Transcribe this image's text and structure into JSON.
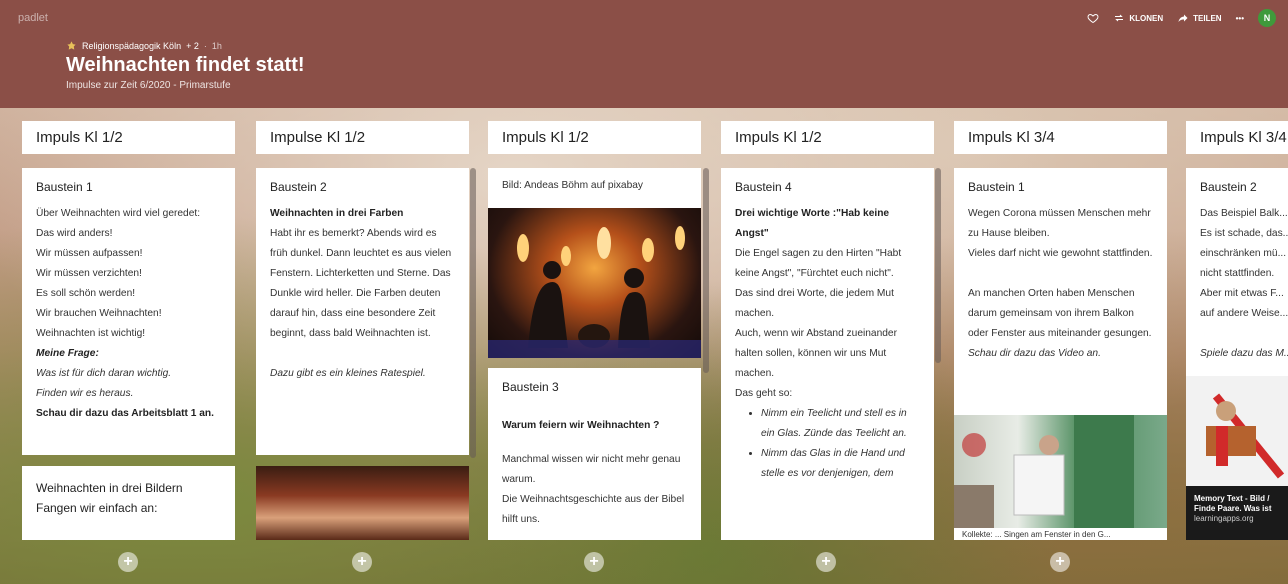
{
  "app": {
    "brand": "padlet"
  },
  "actions": {
    "klonen_label": "KLONEN",
    "teilen_label": "TEILEN",
    "more_label": "•••",
    "avatar_initial": "N"
  },
  "board": {
    "author": "Religionspädagogik Köln",
    "contributors": "+ 2",
    "sep": "·",
    "time": "1h",
    "title": "Weihnachten findet statt!",
    "subtitle": "Impulse zur Zeit 6/2020 - Primarstufe"
  },
  "columns": [
    {
      "header": "Impuls Kl 1/2",
      "posts": [
        {
          "title": "Baustein 1",
          "lines": [
            "Über Weihnachten wird viel geredet:",
            "Das wird anders!",
            "Wir müssen aufpassen!",
            "Wir müssen verzichten!",
            "Es soll schön werden!",
            "Wir brauchen Weihnachten!",
            "Weihnachten ist wichtig!"
          ],
          "question_label": "Meine Frage:",
          "question_lines": [
            "Was ist für dich daran wichtig.",
            "Finden wir es heraus."
          ],
          "closing": "Schau dir dazu das Arbeitsblatt 1 an."
        },
        {
          "title": "Weihnachten in drei Bildern Fangen wir einfach an:"
        }
      ]
    },
    {
      "header": "Impulse Kl 1/2",
      "posts": [
        {
          "title": "Baustein 2",
          "bold_lead": "Weihnachten in drei Farben",
          "body": "Habt ihr es bemerkt? Abends wird es früh dunkel. Dann leuchtet es aus vielen Fenstern. Lichterketten und Sterne. Das Dunkle wird heller. Die Farben deuten darauf hin, dass eine besondere Zeit beginnt, dass bald Weihnachten ist.",
          "italic_note": "Dazu gibt es ein kleines Ratespiel."
        }
      ]
    },
    {
      "header": "Impuls Kl 1/2",
      "posts": [
        {
          "caption": "Bild: Andeas Böhm auf pixabay"
        },
        {
          "title": "Baustein 3",
          "bold_lead": "Warum feiern wir Weihnachten ?",
          "body_lines": [
            "Manchmal wissen wir nicht mehr genau warum.",
            "Die Weihnachtsgeschichte aus der Bibel hilft uns."
          ]
        }
      ]
    },
    {
      "header": "Impuls Kl 1/2",
      "posts": [
        {
          "title": "Baustein 4",
          "bold_lead": "Drei wichtige Worte :\"Hab keine Angst\"",
          "body_lines": [
            "Die Engel sagen zu den Hirten \"Habt keine Angst\", \"Fürchtet euch nicht\".",
            "Das sind drei Worte, die jedem Mut machen.",
            "Auch, wenn wir Abstand zueinander halten sollen, können wir uns Mut machen.",
            "Das geht so:"
          ],
          "bullets": [
            "Nimm ein Teelicht und stell es in ein Glas. Zünde das Teelicht an.",
            "Nimm das Glas in die Hand und stelle es vor denjenigen, dem"
          ]
        }
      ]
    },
    {
      "header": "Impuls Kl 3/4",
      "posts": [
        {
          "title": "Baustein 1",
          "body_lines": [
            "Wegen Corona müssen Menschen mehr zu Hause bleiben.",
            "Vieles darf nicht wie gewohnt stattfinden.",
            "",
            "An manchen Orten haben Menschen darum gemeinsam von ihrem Balkon oder Fenster aus miteinander gesungen."
          ],
          "italic_note": "Schau dir dazu das Video an.",
          "image_caption": "Kollekte: ... Singen am Fenster in den G..."
        }
      ]
    },
    {
      "header": "Impuls Kl 3/4",
      "posts": [
        {
          "title": "Baustein 2",
          "body_lines": [
            "Das Beispiel Balk...",
            "Es ist schade, das...",
            "einschränken mü...",
            "nicht stattfinden.",
            "Aber mit etwas F...",
            "auf andere Weise..."
          ],
          "italic_note": "Spiele dazu das M...",
          "card_title": "Memory Text - Bild /",
          "card_text": "Finde Paare. Was ist",
          "card_source": "learningapps.org"
        }
      ]
    }
  ],
  "colors": {
    "header_bg": "#8b4f47",
    "avatar_bg": "#3f9a3b"
  }
}
